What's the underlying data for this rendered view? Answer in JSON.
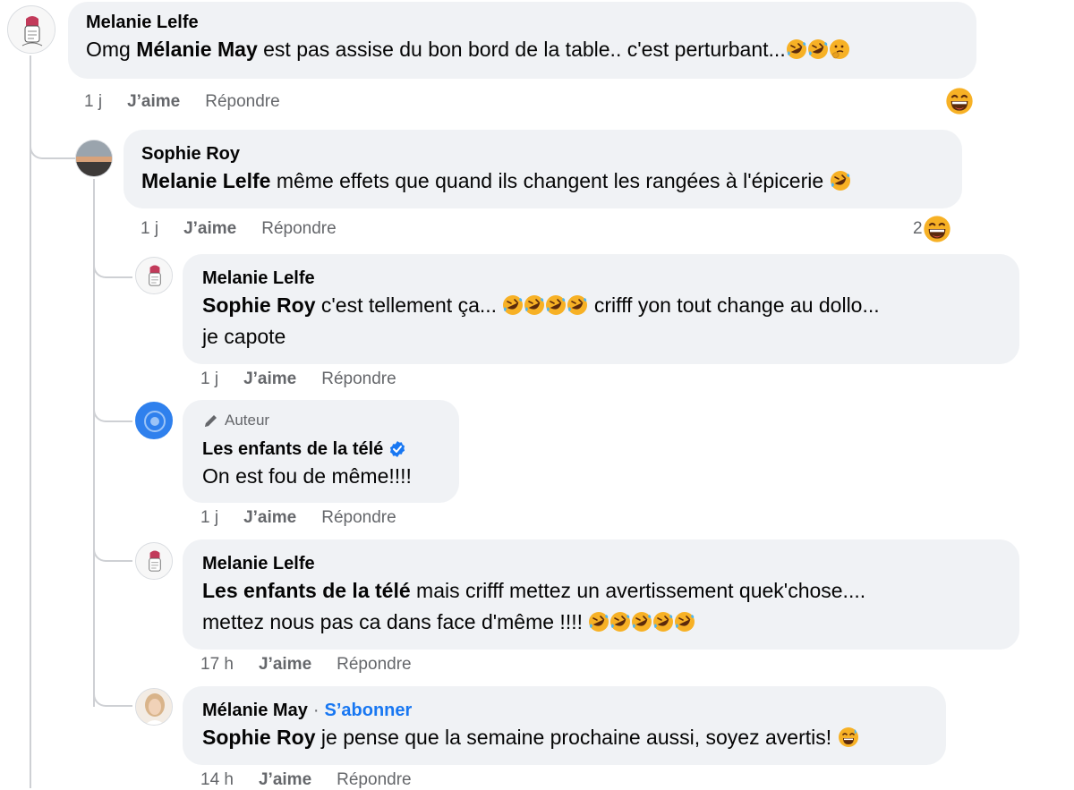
{
  "comments": [
    {
      "author": "Melanie Lelfe",
      "segments": [
        {
          "text": "Omg ",
          "bold": false
        },
        {
          "text": "Mélanie May",
          "bold": true
        },
        {
          "text": " est pas assise du bon bord de la table.. c'est perturbant...",
          "bold": false
        }
      ],
      "emojis": [
        "rofl-emoji",
        "rofl-emoji",
        "thinking-emoji"
      ],
      "time": "1 j",
      "like": "J’aime",
      "reply": "Répondre",
      "reaction_icon": "grin-emoji"
    },
    {
      "author": "Sophie Roy",
      "segments": [
        {
          "text": "Melanie Lelfe",
          "bold": true
        },
        {
          "text": " même effets que quand ils changent les rangées à l'épicerie ",
          "bold": false
        }
      ],
      "emojis": [
        "rofl-emoji"
      ],
      "time": "1 j",
      "like": "J’aime",
      "reply": "Répondre",
      "reaction_count": "2",
      "reaction_icon": "grin-emoji"
    },
    {
      "author": "Melanie Lelfe",
      "line1": [
        {
          "text": "Sophie Roy",
          "bold": true
        },
        {
          "text": " c'est tellement ça... ",
          "bold": false
        }
      ],
      "line1_emojis": [
        "rofl-emoji",
        "rofl-emoji",
        "rofl-emoji",
        "rofl-emoji"
      ],
      "line1_tail": " crifff yon tout change au dollo...",
      "line2": "je capote",
      "time": "1 j",
      "like": "J’aime",
      "reply": "Répondre"
    },
    {
      "role": "Auteur",
      "author": "Les enfants de la télé",
      "verified": true,
      "text": "On est fou de même!!!!",
      "time": "1 j",
      "like": "J’aime",
      "reply": "Répondre"
    },
    {
      "author": "Melanie Lelfe",
      "line1": [
        {
          "text": "Les enfants de la télé",
          "bold": true
        },
        {
          "text": " mais crifff mettez un avertissement quek'chose....",
          "bold": false
        }
      ],
      "line2": "mettez nous pas ca dans face d'même !!!! ",
      "line2_emojis": [
        "rofl-emoji",
        "rofl-emoji",
        "rofl-emoji",
        "rofl-emoji",
        "rofl-emoji"
      ],
      "time": "17 h",
      "like": "J’aime",
      "reply": "Répondre"
    },
    {
      "author": "Mélanie May",
      "follow": "S’abonner",
      "separator": "·",
      "segments": [
        {
          "text": "Sophie Roy",
          "bold": true
        },
        {
          "text": " je pense que la semaine prochaine aussi, soyez avertis! ",
          "bold": false
        }
      ],
      "emojis": [
        "sweat-smile-emoji"
      ],
      "time": "14 h",
      "like": "J’aime",
      "reply": "Répondre"
    }
  ],
  "colors": {
    "bubble": "#f0f2f5",
    "meta": "#65676b",
    "link": "#1877f2",
    "emoji_yellow": "#f7b125",
    "verified": "#1877f2"
  }
}
